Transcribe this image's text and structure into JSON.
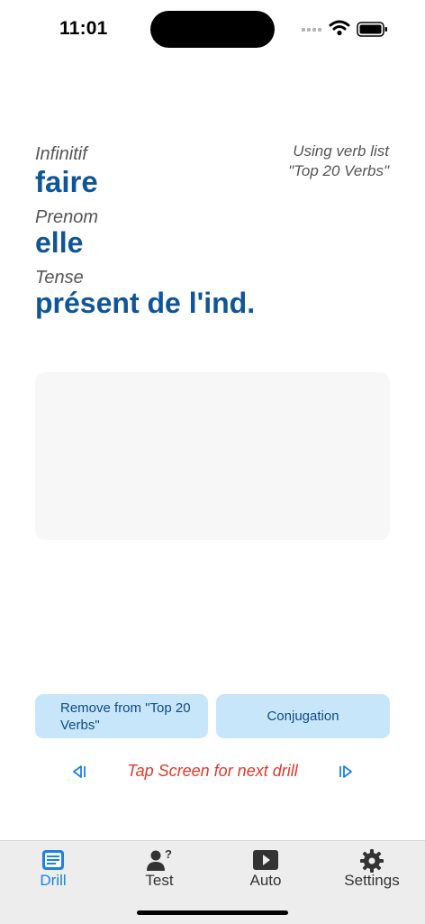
{
  "status": {
    "time": "11:01"
  },
  "fields": [
    {
      "label": "Infinitif",
      "value": "faire"
    },
    {
      "label": "Prenom",
      "value": "elle"
    },
    {
      "label": "Tense",
      "value": "présent de l'ind."
    }
  ],
  "verb_list": {
    "line1": "Using verb list",
    "line2": "\"Top 20 Verbs\""
  },
  "buttons": {
    "remove": "Remove from \"Top 20 Verbs\"",
    "conjugation": "Conjugation"
  },
  "hint": "Tap Screen for next drill",
  "tabs": [
    {
      "label": "Drill",
      "icon": "drill-icon",
      "active": true
    },
    {
      "label": "Test",
      "icon": "person-question-icon",
      "active": false
    },
    {
      "label": "Auto",
      "icon": "play-icon",
      "active": false
    },
    {
      "label": "Settings",
      "icon": "gear-icon",
      "active": false
    }
  ],
  "colors": {
    "accent": "#0f5598",
    "tab_active": "#1a82e2",
    "hint": "#e0392b",
    "button_bg": "#c8e6fa"
  }
}
